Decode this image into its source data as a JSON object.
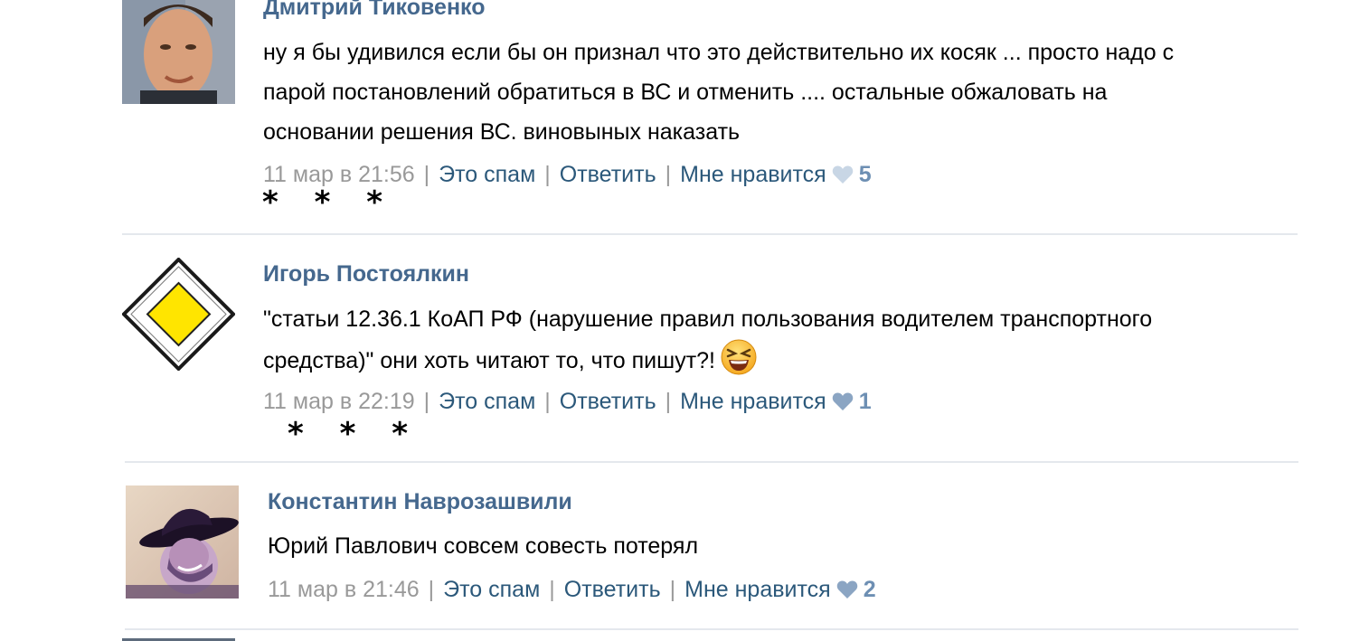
{
  "comments": [
    {
      "author": "Дмитрий Тиковенко",
      "text_lines": [
        "ну я бы удивился если бы он признал что это действительно их косяк ... просто надо с",
        "парой постановлений обратиться в ВС и отменить .... остальные обжаловать на",
        "основании решения ВС. виновыных наказать"
      ],
      "date": "11 мар в 21:56",
      "spam_label": "Это спам",
      "reply_label": "Ответить",
      "like_label": "Мне нравится",
      "likes": "5"
    },
    {
      "author": "Игорь Постоялкин",
      "text_lines": [
        "\"статьи 12.36.1 КоАП РФ (нарушение правил пользования водителем транспортного",
        "средства)\" они хоть читают то, что пишут?!"
      ],
      "date": "11 мар в 22:19",
      "spam_label": "Это спам",
      "reply_label": "Ответить",
      "like_label": "Мне нравится",
      "likes": "1"
    },
    {
      "author": "Константин Наврозашвили",
      "text_lines": [
        "Юрий Павлович совсем совесть потерял"
      ],
      "date": "11 мар в 21:46",
      "spam_label": "Это спам",
      "reply_label": "Ответить",
      "like_label": "Мне нравится",
      "likes": "2"
    }
  ],
  "separator_stars": "* * *",
  "colors": {
    "author": "#45688e",
    "link": "#2b587a",
    "meta": "#999999",
    "like_count": "#6d8fb3",
    "divider": "#e4e8ed"
  }
}
